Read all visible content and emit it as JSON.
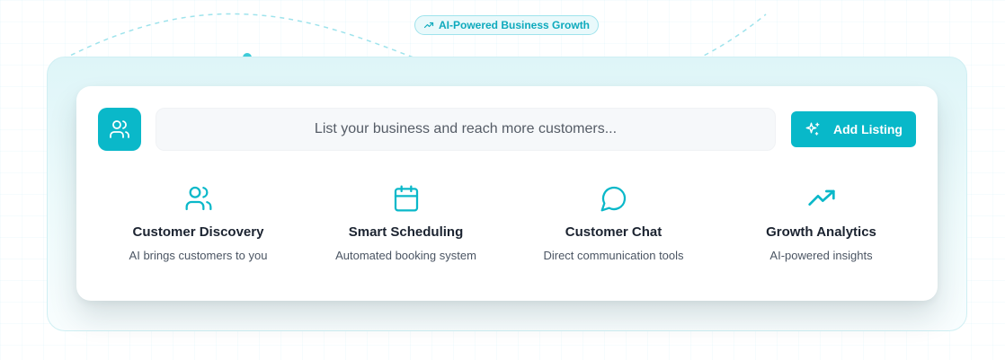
{
  "badge": {
    "icon": "trending-up-icon",
    "label": "AI-Powered Business Growth"
  },
  "listing_bar": {
    "avatar_icon": "users-icon",
    "placeholder": "List your business and reach more customers...",
    "button": {
      "icon": "sparkles-icon",
      "label": "Add Listing"
    }
  },
  "features": [
    {
      "icon": "users-icon",
      "title": "Customer Discovery",
      "description": "AI brings customers to you"
    },
    {
      "icon": "calendar-icon",
      "title": "Smart Scheduling",
      "description": "Automated booking system"
    },
    {
      "icon": "message-circle-icon",
      "title": "Customer Chat",
      "description": "Direct communication tools"
    },
    {
      "icon": "trending-up-icon",
      "title": "Growth Analytics",
      "description": "AI-powered insights"
    }
  ],
  "colors": {
    "accent": "#08b8c9",
    "accent_light": "#e9f9fb",
    "panel": "#def5f8",
    "title_text": "#1b2330",
    "body_text": "#4b5563"
  }
}
